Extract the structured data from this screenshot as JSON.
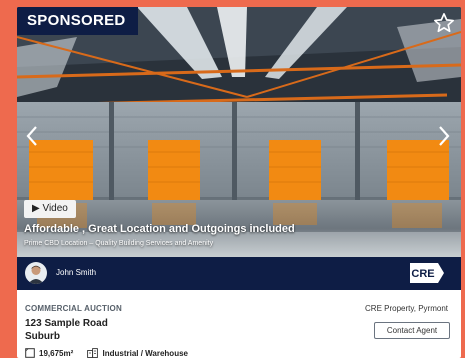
{
  "listing": {
    "sponsored_label": "SPONSORED",
    "video_label": "▶ Video",
    "headline": "Affordable , Great Location and Outgoings included",
    "subheadline": "Prime CBD Location – Quality Building Services and Amenity",
    "agent_name": "John Smith",
    "agency_logo_text": "CRE",
    "listing_type": "COMMERCIAL AUCTION",
    "agency_name": "CRE Property, Pyrmont",
    "address_line1": "123 Sample Road",
    "address_line2": "Suburb",
    "contact_label": "Contact Agent",
    "area": "19,675m²",
    "property_type": "Industrial / Warehouse"
  },
  "colors": {
    "page_background": "#ee6a4e",
    "brand_navy": "#0e1d45",
    "roller_door": "#f28a12"
  },
  "icons": {
    "favorite": "star-outline-icon",
    "prev": "chevron-left-icon",
    "next": "chevron-right-icon",
    "area": "floor-area-icon",
    "type": "building-icon"
  }
}
